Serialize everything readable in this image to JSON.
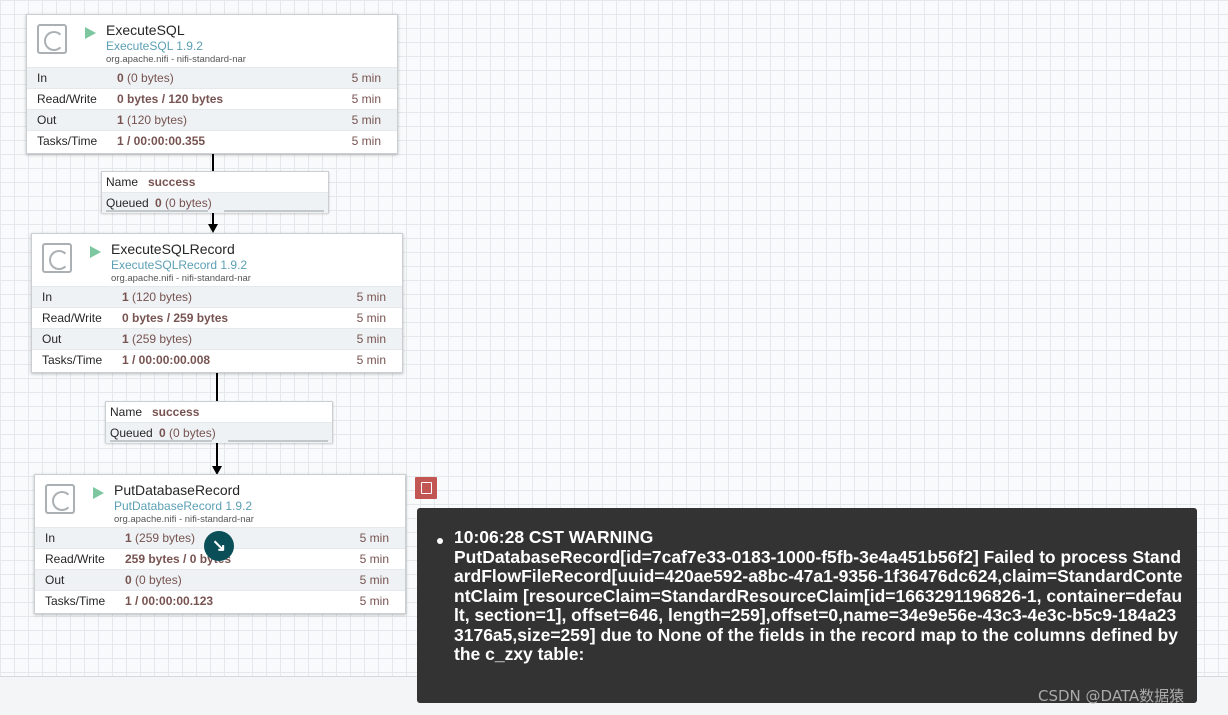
{
  "processors": [
    {
      "name": "ExecuteSQL",
      "type": "ExecuteSQL 1.9.2",
      "bundle": "org.apache.nifi - nifi-standard-nar",
      "stats": [
        {
          "label": "In",
          "bold": "0",
          "sub": " (0 bytes)",
          "time": "5 min"
        },
        {
          "label": "Read/Write",
          "bold": "0 bytes / 120 bytes",
          "sub": "",
          "time": "5 min"
        },
        {
          "label": "Out",
          "bold": "1",
          "sub": " (120 bytes)",
          "time": "5 min"
        },
        {
          "label": "Tasks/Time",
          "bold": "1 / 00:00:00.355",
          "sub": "",
          "time": "5 min"
        }
      ]
    },
    {
      "name": "ExecuteSQLRecord",
      "type": "ExecuteSQLRecord 1.9.2",
      "bundle": "org.apache.nifi - nifi-standard-nar",
      "stats": [
        {
          "label": "In",
          "bold": "1",
          "sub": " (120 bytes)",
          "time": "5 min"
        },
        {
          "label": "Read/Write",
          "bold": "0 bytes / 259 bytes",
          "sub": "",
          "time": "5 min"
        },
        {
          "label": "Out",
          "bold": "1",
          "sub": " (259 bytes)",
          "time": "5 min"
        },
        {
          "label": "Tasks/Time",
          "bold": "1 / 00:00:00.008",
          "sub": "",
          "time": "5 min"
        }
      ]
    },
    {
      "name": "PutDatabaseRecord",
      "type": "PutDatabaseRecord 1.9.2",
      "bundle": "org.apache.nifi - nifi-standard-nar",
      "stats": [
        {
          "label": "In",
          "bold": "1",
          "sub": " (259 bytes)",
          "time": "5 min"
        },
        {
          "label": "Read/Write",
          "bold": "259 bytes / 0 bytes",
          "sub": "",
          "time": "5 min"
        },
        {
          "label": "Out",
          "bold": "0",
          "sub": " (0 bytes)",
          "time": "5 min"
        },
        {
          "label": "Tasks/Time",
          "bold": "1 / 00:00:00.123",
          "sub": "",
          "time": "5 min"
        }
      ]
    }
  ],
  "connections": [
    {
      "name_key": "Name",
      "name_value": "success",
      "queued_key": "Queued",
      "queued_count": "0",
      "queued_size": " (0 bytes)"
    },
    {
      "name_key": "Name",
      "name_value": "success",
      "queued_key": "Queued",
      "queued_count": "0",
      "queued_size": " (0 bytes)"
    }
  ],
  "bulletin": {
    "header": "10:06:28 CST  WARNING",
    "message": "PutDatabaseRecord[id=7caf7e33-0183-1000-f5fb-3e4a451b56f2] Failed to process StandardFlowFileRecord[uuid=420ae592-a8bc-47a1-9356-1f36476dc624,claim=StandardContentClaim [resourceClaim=StandardResourceClaim[id=1663291196826-1, container=default, section=1], offset=646, length=259],offset=0,name=34e9e56e-43c3-4e3c-b5c9-184a233176a5,size=259] due to None of the fields in the record map to the columns defined by the c_zxy table:"
  },
  "watermark": "CSDN @DATA数据猿",
  "colors": {
    "accent": "#5b9fb5",
    "run": "#7dc7a0",
    "warning": "#c15652",
    "stat": "#775351"
  },
  "icons": [
    "processor-icon",
    "run-icon",
    "bulletin-icon",
    "cursor-icon"
  ]
}
